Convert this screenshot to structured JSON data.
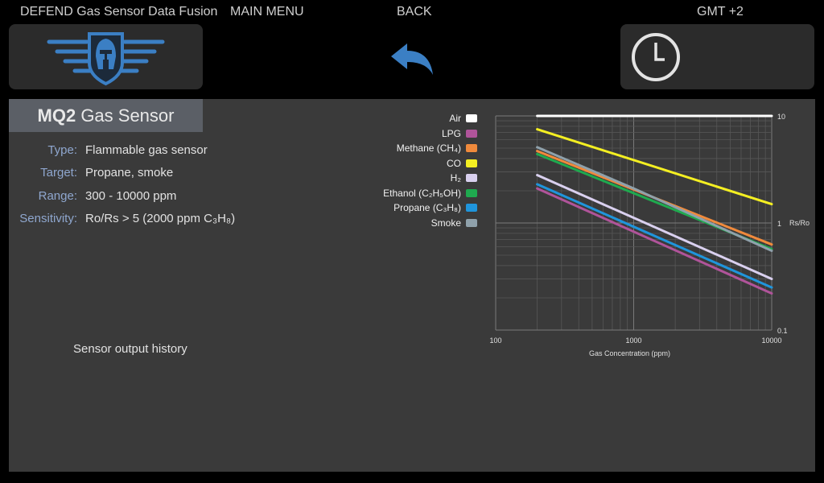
{
  "topbar": {
    "app_title": "DEFEND Gas Sensor Data Fusion",
    "main_menu_label": "MAIN MENU",
    "back_label": "BACK",
    "timezone_label": "GMT +2"
  },
  "sensor": {
    "name_bold": "MQ2",
    "name_rest": "Gas Sensor",
    "specs": [
      {
        "key": "Type:",
        "value": "Flammable gas sensor"
      },
      {
        "key": "Target:",
        "value": "Propane, smoke"
      },
      {
        "key": "Range:",
        "value": "300 - 10000 ppm"
      },
      {
        "key": "Sensitivity:",
        "value": "Ro/Rs > 5 (2000 ppm C₃H₈)"
      }
    ],
    "history_label": "Sensor output history"
  },
  "chart_data": {
    "type": "line",
    "xlabel": "Gas Concentration (ppm)",
    "ylabel": "Rs/Ro",
    "x_scale": "log",
    "y_scale": "log",
    "xlim": [
      100,
      10000
    ],
    "ylim": [
      0.1,
      10
    ],
    "x_ticks": [
      "100",
      "1000",
      "10000"
    ],
    "y_ticks": [
      "10",
      "1",
      "0.1"
    ],
    "grid": true,
    "legend_placement": "left",
    "series": [
      {
        "name": "Air",
        "color": "#ffffff",
        "x": [
          200,
          10000
        ],
        "y": [
          10,
          10
        ]
      },
      {
        "name": "LPG",
        "color": "#b0549a",
        "x": [
          200,
          10000
        ],
        "y": [
          2.1,
          0.22
        ]
      },
      {
        "name": "Methane (CH₄)",
        "color": "#f08a3c",
        "x": [
          200,
          10000
        ],
        "y": [
          4.7,
          0.63
        ]
      },
      {
        "name": "CO",
        "color": "#f4ef22",
        "x": [
          200,
          10000
        ],
        "y": [
          7.5,
          1.5
        ]
      },
      {
        "name": "H₂",
        "color": "#d9d0ef",
        "x": [
          200,
          10000
        ],
        "y": [
          2.8,
          0.3
        ]
      },
      {
        "name": "Ethanol (C₂H₅OH)",
        "color": "#1faa4f",
        "x": [
          200,
          10000
        ],
        "y": [
          4.4,
          0.57
        ]
      },
      {
        "name": "Propane (C₃H₈)",
        "color": "#1f95dc",
        "x": [
          200,
          10000
        ],
        "y": [
          2.3,
          0.25
        ]
      },
      {
        "name": "Smoke",
        "color": "#8fa1ab",
        "x": [
          200,
          1000,
          10000
        ],
        "y": [
          5.1,
          2.1,
          0.55
        ]
      }
    ]
  }
}
